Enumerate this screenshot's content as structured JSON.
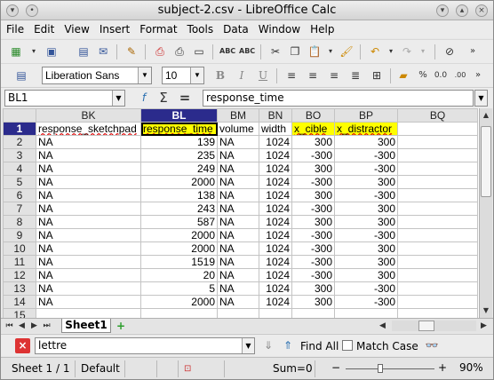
{
  "window": {
    "title": "subject-2.csv - LibreOffice Calc"
  },
  "menu": [
    "File",
    "Edit",
    "View",
    "Insert",
    "Format",
    "Tools",
    "Data",
    "Window",
    "Help"
  ],
  "format": {
    "font_name": "Liberation Sans",
    "font_size": "10"
  },
  "formula_bar": {
    "name_box": "BL1",
    "sigma": "Σ",
    "equals": "=",
    "content": "response_time"
  },
  "grid": {
    "columns": [
      "BK",
      "BL",
      "BM",
      "BN",
      "BO",
      "BP",
      "BQ"
    ],
    "rows": [
      {
        "n": "1",
        "cells": [
          "response_sketchpad",
          "response_time",
          "volume",
          "width",
          "x_cible",
          "x_distractor",
          ""
        ]
      },
      {
        "n": "2",
        "cells": [
          "NA",
          "139",
          "NA",
          "1024",
          "300",
          "300",
          ""
        ]
      },
      {
        "n": "3",
        "cells": [
          "NA",
          "235",
          "NA",
          "1024",
          "-300",
          "-300",
          ""
        ]
      },
      {
        "n": "4",
        "cells": [
          "NA",
          "249",
          "NA",
          "1024",
          "300",
          "-300",
          ""
        ]
      },
      {
        "n": "5",
        "cells": [
          "NA",
          "2000",
          "NA",
          "1024",
          "-300",
          "300",
          ""
        ]
      },
      {
        "n": "6",
        "cells": [
          "NA",
          "138",
          "NA",
          "1024",
          "300",
          "-300",
          ""
        ]
      },
      {
        "n": "7",
        "cells": [
          "NA",
          "243",
          "NA",
          "1024",
          "-300",
          "300",
          ""
        ]
      },
      {
        "n": "8",
        "cells": [
          "NA",
          "587",
          "NA",
          "1024",
          "300",
          "300",
          ""
        ]
      },
      {
        "n": "9",
        "cells": [
          "NA",
          "2000",
          "NA",
          "1024",
          "-300",
          "-300",
          ""
        ]
      },
      {
        "n": "10",
        "cells": [
          "NA",
          "2000",
          "NA",
          "1024",
          "-300",
          "300",
          ""
        ]
      },
      {
        "n": "11",
        "cells": [
          "NA",
          "1519",
          "NA",
          "1024",
          "-300",
          "300",
          ""
        ]
      },
      {
        "n": "12",
        "cells": [
          "NA",
          "20",
          "NA",
          "1024",
          "-300",
          "300",
          ""
        ]
      },
      {
        "n": "13",
        "cells": [
          "NA",
          "5",
          "NA",
          "1024",
          "300",
          "-300",
          ""
        ]
      },
      {
        "n": "14",
        "cells": [
          "NA",
          "2000",
          "NA",
          "1024",
          "300",
          "-300",
          ""
        ]
      },
      {
        "n": "15",
        "cells": [
          "",
          "",
          "",
          "",
          "",
          "",
          ""
        ]
      }
    ]
  },
  "sheet_tab": "Sheet1",
  "find": {
    "value": "lettre",
    "find_all": "Find All",
    "match_case": "Match Case"
  },
  "status": {
    "sheet": "Sheet 1 / 1",
    "style": "Default",
    "sum": "Sum=0",
    "zoom": "90%"
  }
}
